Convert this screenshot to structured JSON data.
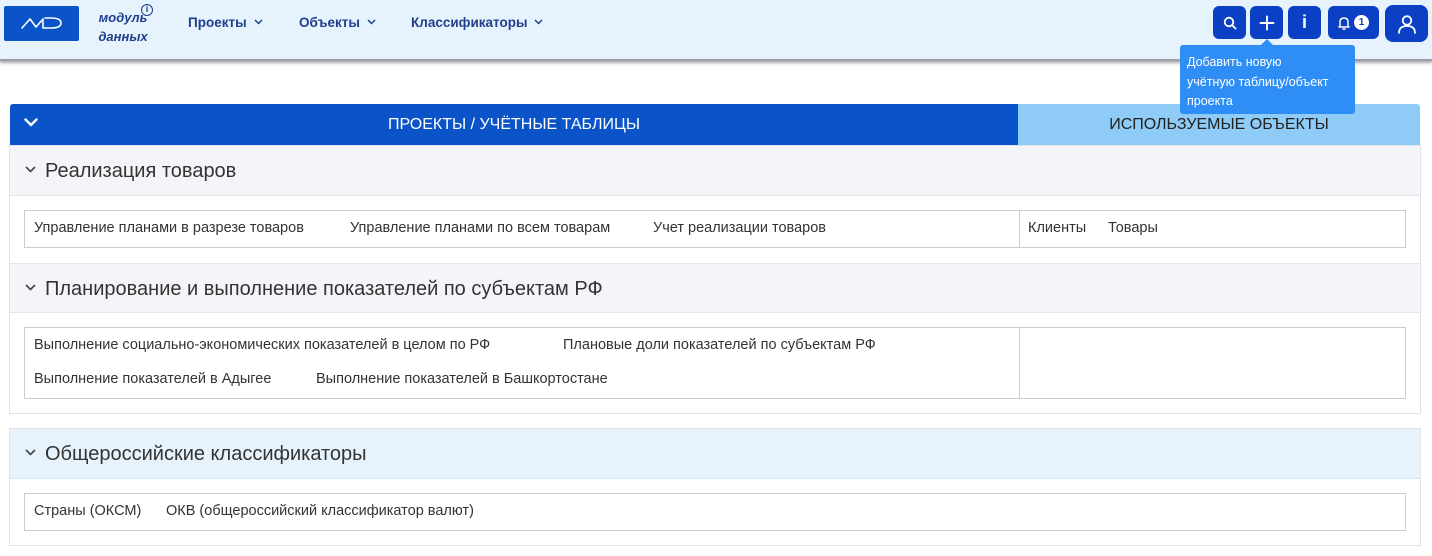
{
  "header": {
    "module_label_line1": "модуль",
    "module_label_line2": "данных",
    "info_mark": "i",
    "nav": [
      {
        "label": "Проекты"
      },
      {
        "label": "Объекты"
      },
      {
        "label": "Классификаторы"
      }
    ],
    "toolbar": {
      "search_icon": "search-icon",
      "add_icon": "plus-icon",
      "info_label": "i",
      "notifications_count": "1",
      "user_icon": "user-icon"
    },
    "tooltip_lines": [
      "Добавить новую",
      "учётную таблицу/объект",
      "проекта"
    ]
  },
  "tabs": {
    "projects_label": "ПРОЕКТЫ / УЧЁТНЫЕ ТАБЛИЦЫ",
    "objects_label": "ИСПОЛЬЗУЕМЫЕ ОБЪЕКТЫ"
  },
  "groups": [
    {
      "title": "Реализация товаров",
      "tables": [
        "Управление планами в разрезе товаров",
        "Управление планами по всем товарам",
        "Учет реализации товаров"
      ],
      "objects": [
        "Клиенты",
        "Товары"
      ]
    },
    {
      "title": "Планирование и выполнение показателей по субъектам РФ",
      "tables_row1": [
        "Выполнение социально-экономических показателей в целом по РФ",
        "Плановые доли показателей по субъектам РФ"
      ],
      "tables_row2": [
        "Выполнение показателей в Адыгее",
        "Выполнение показателей в Башкортостане"
      ],
      "objects": []
    }
  ],
  "classifiers": {
    "title": "Общероссийские классификаторы",
    "items": [
      "Страны (ОКСМ)",
      "ОКВ (общероссийский классификатор валют)"
    ]
  },
  "colors": {
    "brand_blue": "#0b53c8",
    "button_blue": "#0b3fc4",
    "light_tab": "#8ecbf7",
    "header_bg": "#e6f3fc",
    "tooltip_bg": "#2e8ef5"
  }
}
